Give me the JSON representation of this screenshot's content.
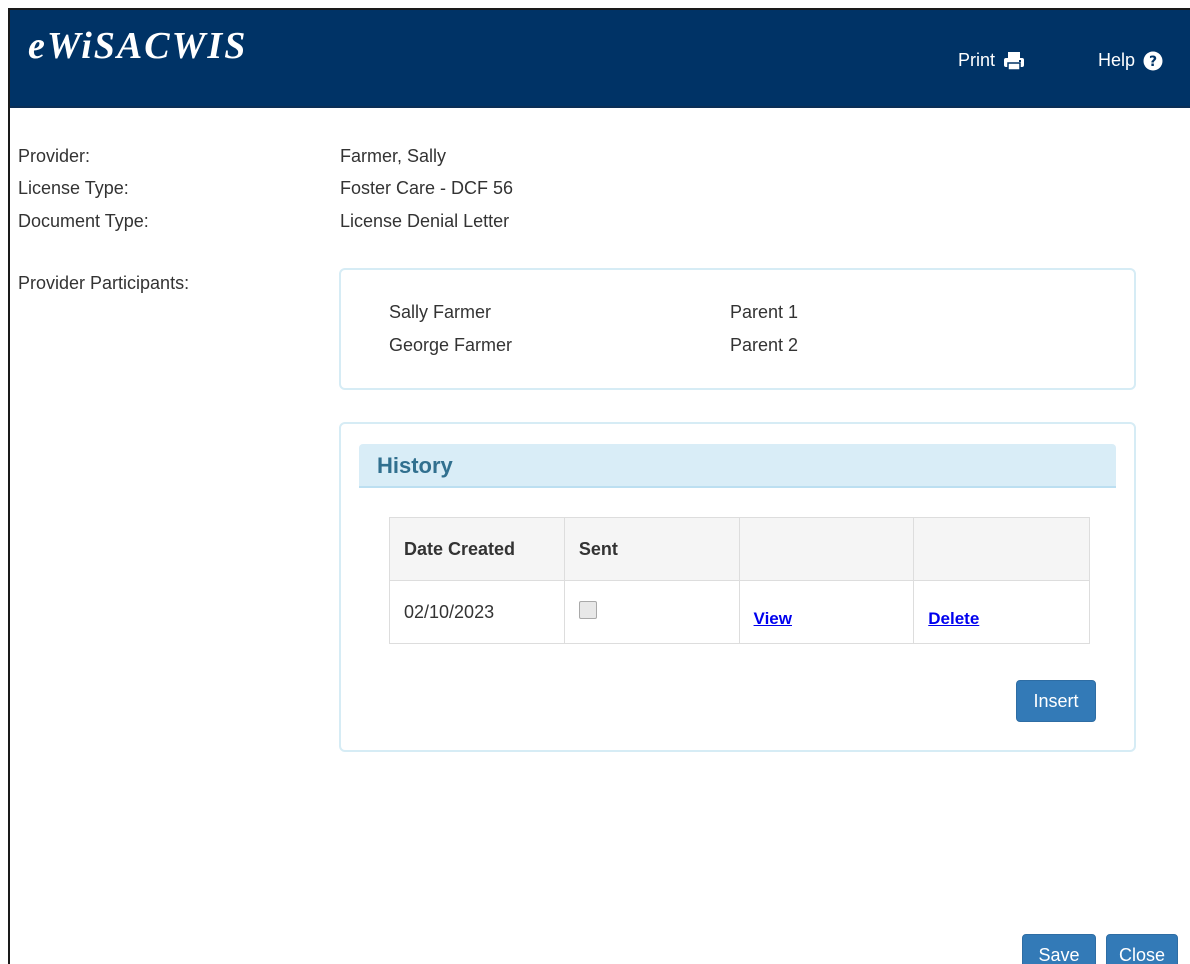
{
  "header": {
    "app_title": "eWiSACWIS",
    "print_label": "Print",
    "help_label": "Help",
    "icons": {
      "print": "printer-icon",
      "help": "question-circle-icon"
    }
  },
  "provider_info": {
    "provider_label": "Provider:",
    "provider_value": "Farmer, Sally",
    "license_type_label": "License Type:",
    "license_type_value": "Foster Care - DCF 56",
    "document_type_label": "Document Type:",
    "document_type_value": "License Denial Letter",
    "participants_label": "Provider Participants:"
  },
  "participants": [
    {
      "name": "Sally  Farmer",
      "role": "Parent 1"
    },
    {
      "name": "George  Farmer",
      "role": "Parent 2"
    }
  ],
  "history": {
    "title": "History",
    "columns": [
      "Date Created",
      "Sent",
      "",
      ""
    ],
    "rows": [
      {
        "date_created": "02/10/2023",
        "sent": false,
        "view_label": "View",
        "delete_label": "Delete"
      }
    ],
    "insert_label": "Insert"
  },
  "footer": {
    "save_label": "Save",
    "close_label": "Close"
  },
  "colors": {
    "header_bg": "#003366",
    "button_bg": "#337ab7",
    "panel_border": "#d6ecf5",
    "section_title_bg": "#d9edf7",
    "section_title_text": "#31708f",
    "link": "#0000ee"
  }
}
